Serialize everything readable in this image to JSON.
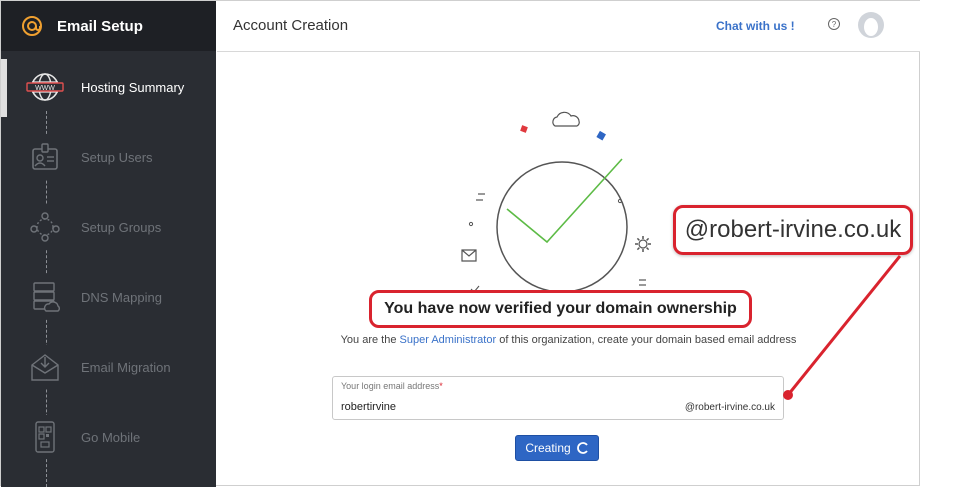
{
  "sidebar": {
    "title": "Email Setup",
    "steps": [
      {
        "label": "Hosting Summary",
        "icon": "www-globe-icon",
        "active": true
      },
      {
        "label": "Setup Users",
        "icon": "id-card-icon",
        "active": false
      },
      {
        "label": "Setup Groups",
        "icon": "group-network-icon",
        "active": false
      },
      {
        "label": "DNS Mapping",
        "icon": "server-cloud-icon",
        "active": false
      },
      {
        "label": "Email Migration",
        "icon": "envelope-download-icon",
        "active": false
      },
      {
        "label": "Go Mobile",
        "icon": "mobile-qr-icon",
        "active": false
      }
    ]
  },
  "header": {
    "title": "Account Creation",
    "chat_label": "Chat with us !",
    "help_icon": "question-circle-icon",
    "avatar_icon": "user-avatar-icon"
  },
  "main": {
    "headline": "You have now verified your domain ownership",
    "subtext_before": "You are the ",
    "subtext_link": "Super Administrator",
    "subtext_after": " of this organization, create your domain based email address",
    "field": {
      "label": "Your login email address",
      "required_mark": "*",
      "value": "robertirvine",
      "domain": "@robert-irvine.co.uk"
    },
    "button_label": "Creating"
  },
  "callout": {
    "text": "@robert-irvine.co.uk"
  },
  "colors": {
    "sidebar_bg": "#2a2d33",
    "accent_red": "#d9232e",
    "link_blue": "#3a72c9",
    "button_blue": "#2e66c4",
    "check_green": "#5dbb46"
  }
}
